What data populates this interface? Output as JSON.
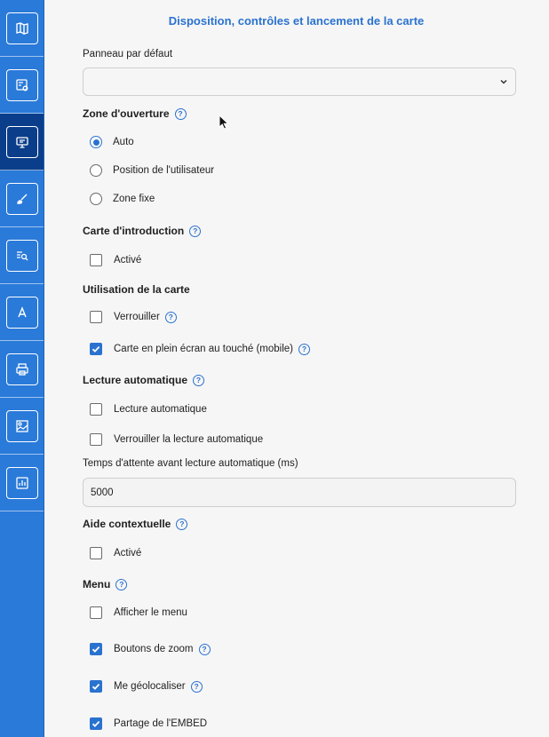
{
  "title": "Disposition, contrôles et lancement de la carte",
  "sidebar": {
    "items": [
      {
        "icon": "map-icon",
        "active": false
      },
      {
        "icon": "map-settings-icon",
        "active": false
      },
      {
        "icon": "presentation-icon",
        "active": true
      },
      {
        "icon": "brush-icon",
        "active": false
      },
      {
        "icon": "search-list-icon",
        "active": false
      },
      {
        "icon": "font-icon",
        "active": false
      },
      {
        "icon": "print-icon",
        "active": false
      },
      {
        "icon": "image-map-icon",
        "active": false
      },
      {
        "icon": "chart-icon",
        "active": false
      }
    ]
  },
  "default_panel": {
    "label": "Panneau par défaut",
    "value": ""
  },
  "zone": {
    "title": "Zone d'ouverture",
    "options": [
      "Auto",
      "Position de l'utilisateur",
      "Zone fixe"
    ],
    "selected": "Auto"
  },
  "intro": {
    "title": "Carte d'introduction",
    "enabled_label": "Activé",
    "enabled": false
  },
  "usage": {
    "title": "Utilisation de la carte",
    "lock_label": "Verrouiller",
    "lock": false,
    "fullscreen_label": "Carte en plein écran au touché (mobile)",
    "fullscreen": true
  },
  "autoplay": {
    "title": "Lecture automatique",
    "autoplay_label": "Lecture automatique",
    "autoplay": false,
    "lock_label": "Verrouiller la lecture automatique",
    "lock": false,
    "delay_label": "Temps d'attente avant lecture automatique (ms)",
    "delay_value": "5000"
  },
  "help": {
    "title": "Aide contextuelle",
    "enabled_label": "Activé",
    "enabled": false
  },
  "menu": {
    "title": "Menu",
    "show_label": "Afficher le menu",
    "show": false,
    "zoom_label": "Boutons de zoom",
    "zoom": true,
    "geo_label": "Me géolocaliser",
    "geo": true,
    "embed_label": "Partage de l'EMBED",
    "embed": true
  },
  "colors": {
    "accent": "#2a72d0",
    "sidebar": "#2a7ad9",
    "sidebar_active": "#0b3e8a"
  }
}
